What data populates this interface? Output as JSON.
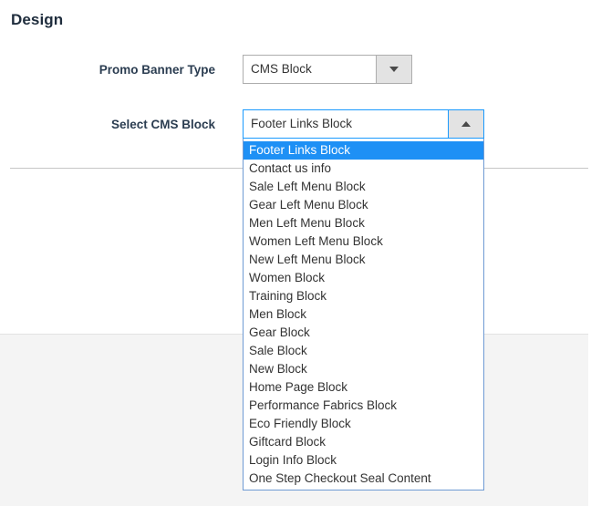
{
  "section": {
    "title": "Design"
  },
  "fields": [
    {
      "label": "Promo Banner Type",
      "control": "select",
      "value": "CMS Block",
      "expanded": false,
      "toggle_icon": "chevron-down-icon"
    },
    {
      "label": "Select CMS Block",
      "control": "select",
      "value": "Footer Links Block",
      "expanded": true,
      "toggle_icon": "chevron-up-icon"
    }
  ],
  "dropdown": {
    "selected": "Footer Links Block",
    "options": [
      "Footer Links Block",
      "Contact us info",
      "Sale Left Menu Block",
      "Gear Left Menu Block",
      "Men Left Menu Block",
      "Women Left Menu Block",
      "New Left Menu Block",
      "Women Block",
      "Training Block",
      "Men Block",
      "Gear Block",
      "Sale Block",
      "New Block",
      "Home Page Block",
      "Performance Fabrics Block",
      "Eco Friendly Block",
      "Giftcard Block",
      "Login Info Block",
      "One Step Checkout Seal Content"
    ]
  },
  "colors": {
    "highlight": "#1e90f5",
    "focus_border": "#1a9afe",
    "list_border": "#6f9bd4",
    "heading_text": "#1f2d3d",
    "label_text": "#2b3d51",
    "body_text": "#333333",
    "panel_bg": "#f4f4f4",
    "divider": "#c6c6c6",
    "toggle_bg": "#e3e3e3"
  }
}
